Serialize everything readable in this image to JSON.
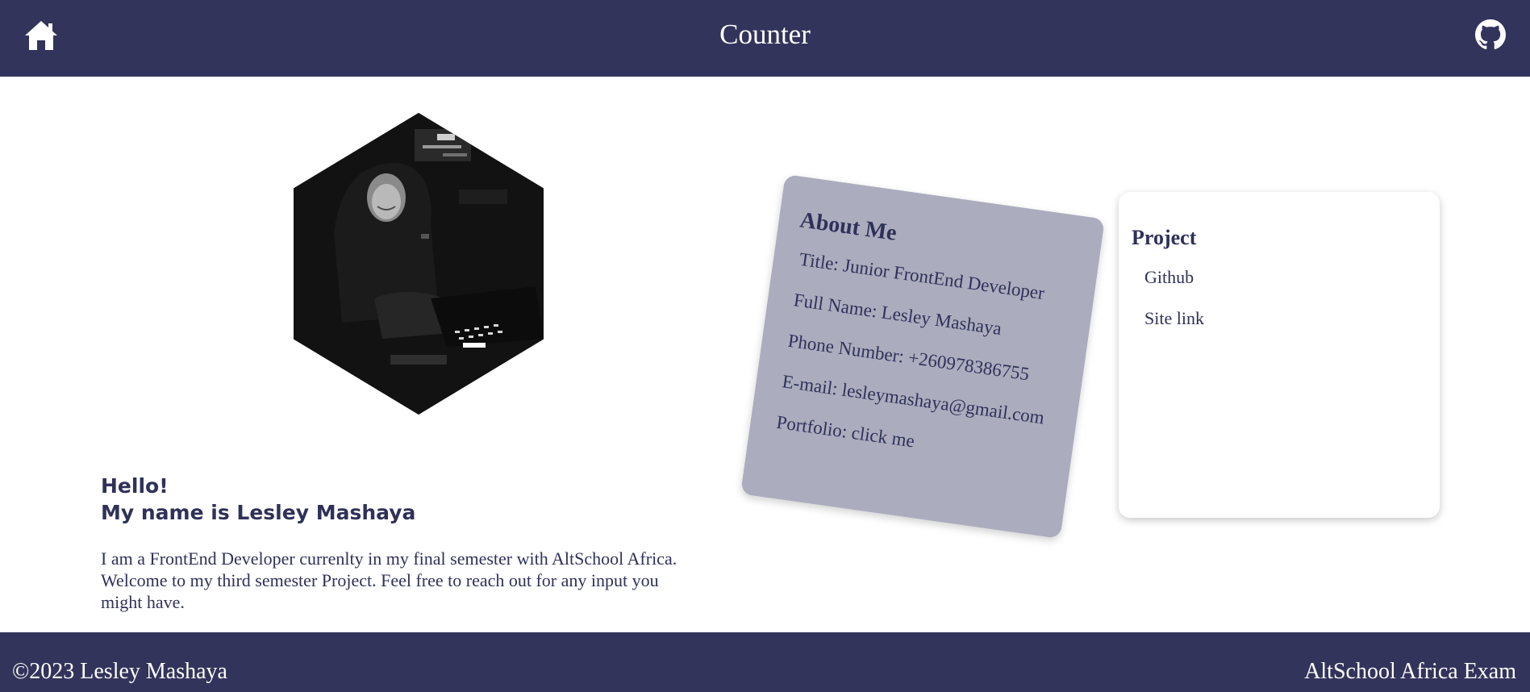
{
  "header": {
    "title": "Counter",
    "home_icon": "home-icon",
    "github_icon": "github-icon",
    "background": "#33345b"
  },
  "profile": {
    "avatar_description_icon": "hooded-person-laptop-photo"
  },
  "intro": {
    "greeting_line1": "Hello!",
    "greeting_line2": "My name is Lesley Mashaya",
    "paragraph": "I am a FrontEnd Developer currenlty in my final semester with AltSchool Africa. Welcome to my third semester Project. Feel free to reach out for any input you might have."
  },
  "about": {
    "title": "About Me",
    "rows": [
      "Title: Junior FrontEnd Developer",
      "Full Name: Lesley Mashaya",
      "Phone Number: +260978386755",
      "E-mail: lesleymashaya@gmail.com"
    ],
    "portfolio_label": "Portfolio: ",
    "portfolio_link": "click me",
    "background": "#abadbe"
  },
  "project": {
    "title": "Project",
    "links": [
      "Github",
      "Site link"
    ]
  },
  "footer": {
    "copyright": "©2023 Lesley Mashaya",
    "exam_label": "AltSchool Africa Exam",
    "background": "#33345b"
  },
  "colors": {
    "text_primary": "#2f3159",
    "accent": "#33345b"
  }
}
